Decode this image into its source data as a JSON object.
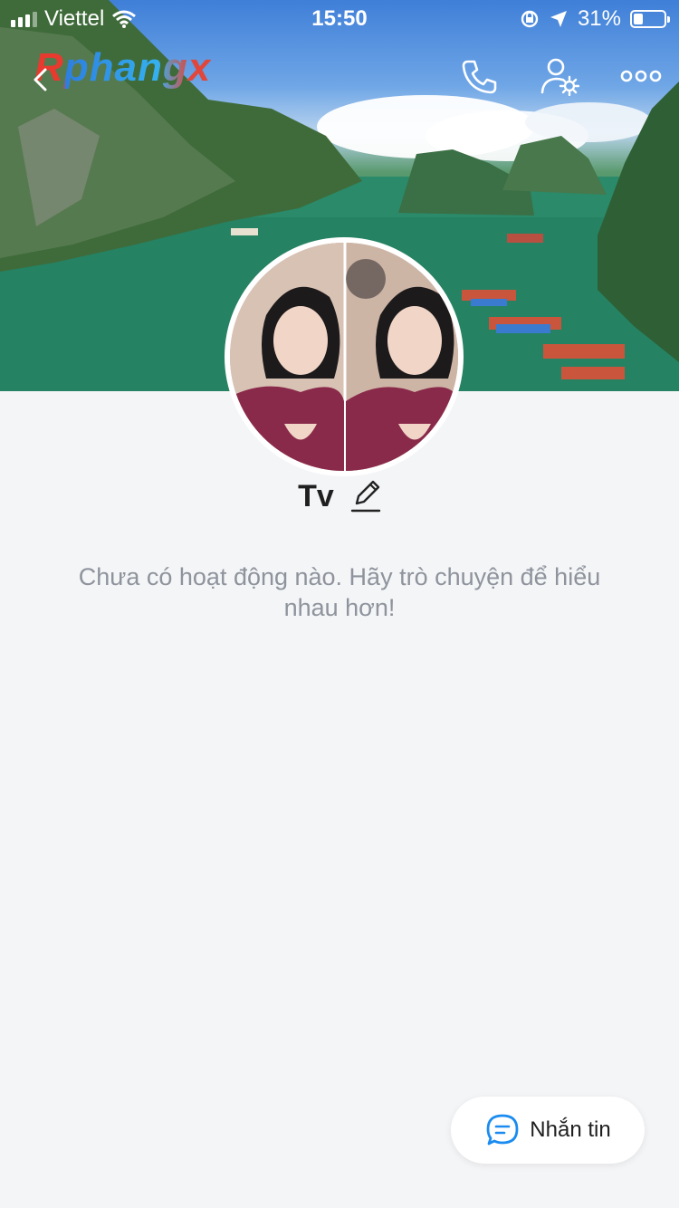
{
  "status_bar": {
    "carrier": "Viettel",
    "time": "15:50",
    "battery_percent": "31%",
    "battery_level": 0.31,
    "signal_bars": 3
  },
  "logo_text": "Rphangx",
  "profile": {
    "name": "Tv",
    "empty_activity_message": "Chưa có hoạt động nào. Hãy trò chuyện để hiểu nhau hơn!"
  },
  "message_button": {
    "label": "Nhắn tin"
  },
  "icons": {
    "back": "chevron-left-icon",
    "call": "phone-icon",
    "user_settings": "user-settings-icon",
    "more": "more-icon",
    "edit": "pencil-icon",
    "chat": "chat-bubble-icon"
  },
  "colors": {
    "accent": "#1a8cf0",
    "background": "#f4f5f7",
    "secondary_text": "#8e939c"
  }
}
